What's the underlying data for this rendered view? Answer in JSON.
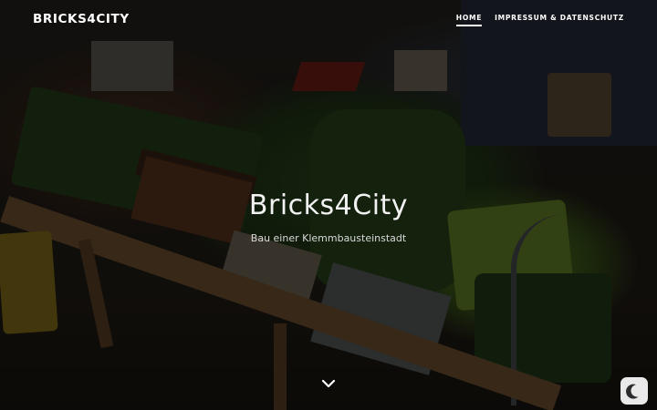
{
  "navbar": {
    "brand": "BRICKS4CITY",
    "links": [
      {
        "label": "HOME",
        "active": true
      },
      {
        "label": "IMPRESSUM & DATENSCHUTZ",
        "active": false
      }
    ]
  },
  "hero": {
    "title": "Bricks4City",
    "subtitle": "Bau einer Klemmbausteinstadt",
    "scroll_icon": "chevron-down-icon"
  },
  "theme_toggle": {
    "icon": "moon-icon",
    "background": "#e9e9ea"
  }
}
